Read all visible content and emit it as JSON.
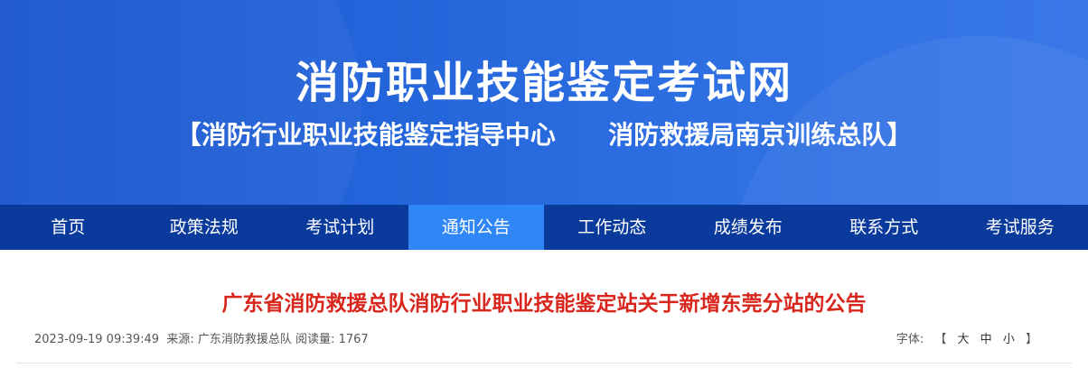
{
  "banner": {
    "title": "消防职业技能鉴定考试网",
    "subtitle_left": "【消防行业职业技能鉴定指导中心",
    "subtitle_right": "消防救援局南京训练总队】"
  },
  "nav": {
    "items": [
      "首页",
      "政策法规",
      "考试计划",
      "通知公告",
      "工作动态",
      "成绩发布",
      "联系方式",
      "考试服务"
    ],
    "active_index": 3
  },
  "article": {
    "title": "广东省消防救援总队消防行业职业技能鉴定站关于新增东莞分站的公告",
    "datetime": "2023-09-19 09:39:49",
    "source_label": "来源:",
    "source": "广东消防救援总队",
    "views_label": "阅读量:",
    "views": "1767"
  },
  "font_size": {
    "label": "字体:",
    "open_bracket": "【",
    "large": "大",
    "medium": "中",
    "small": "小",
    "close_bracket": "】"
  },
  "colors": {
    "banner": "#2a6ce0",
    "nav": "#0a3a9c",
    "nav_active": "#2f86f6",
    "article_title": "#d9261c"
  }
}
